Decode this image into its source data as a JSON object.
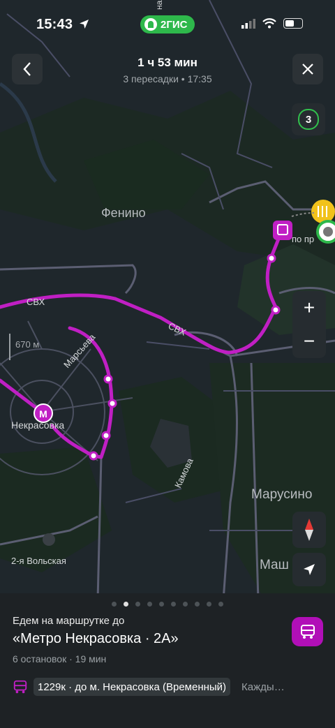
{
  "status_bar": {
    "time": "15:43",
    "app_badge": "2ГИС"
  },
  "header": {
    "duration": "1 ч 53 мин",
    "details": "3 пересадки • 17:35"
  },
  "map": {
    "transfers_count": "3",
    "labels": {
      "fenino": "Фенино",
      "svh_1": "СВХ",
      "svh_2": "СВХ",
      "maresyeva": "Марсьева",
      "nekrasovka": "Некрасовка",
      "kamova": "Камова",
      "marusino": "Марусино",
      "volskaya": "2-я Вольская",
      "mash": "Маш",
      "scale": "670 м",
      "stop_cut": "по пр",
      "top_cut": "ная"
    },
    "metro_symbol": "М",
    "route_color": "#c01fc4"
  },
  "zoom": {
    "in": "+",
    "out": "−"
  },
  "sheet": {
    "segment_label": "Едем на маршрутке до",
    "destination": "«Метро Некрасовка · 2А»",
    "meta": "6 остановок · 19 мин",
    "route_chip": "1229к · до м. Некрасовка (Временный)",
    "frequency": "Кажды…",
    "page_count": 10,
    "active_page": 2
  }
}
